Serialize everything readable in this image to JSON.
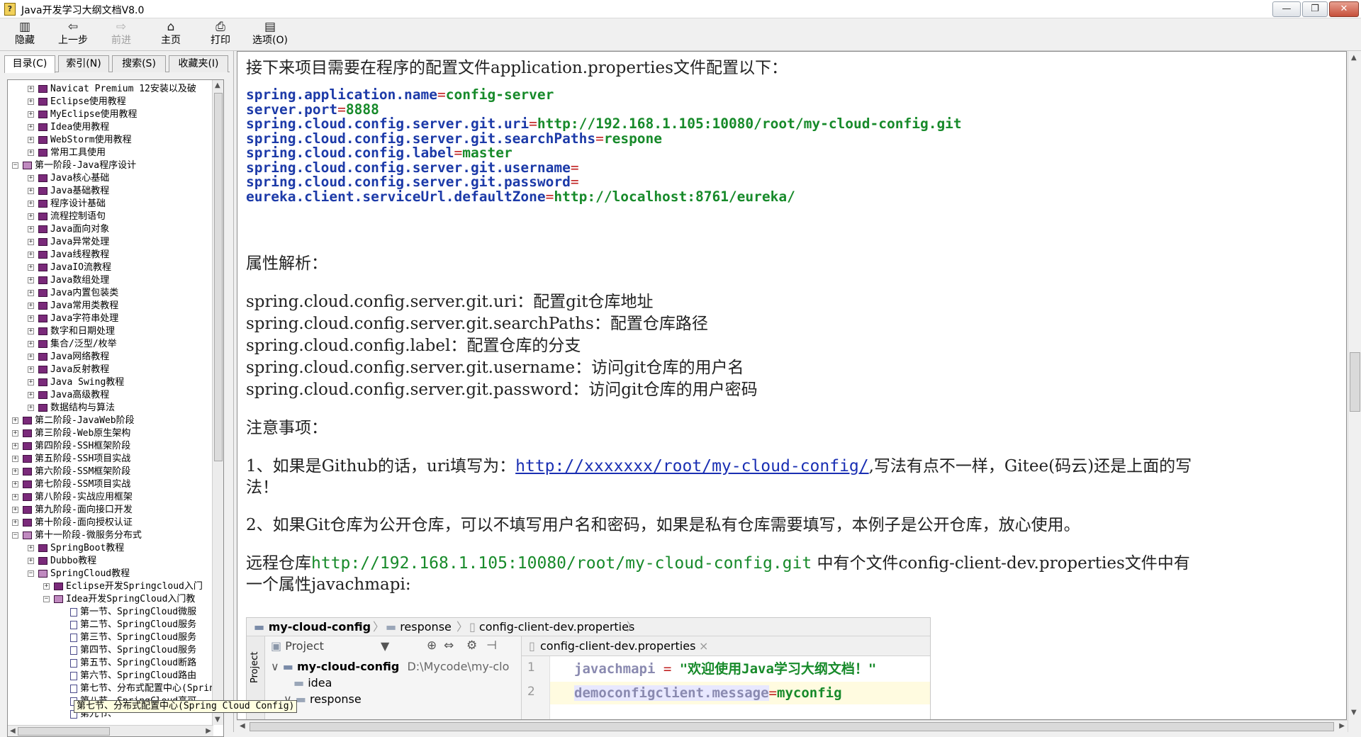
{
  "window": {
    "title": "Java开发学习大纲文档V8.0",
    "app_icon": "?",
    "min_label": "—",
    "max_label": "❐",
    "close_label": "✕"
  },
  "toolbar": {
    "hide": {
      "label": "隐藏",
      "icon": "hide-icon"
    },
    "back": {
      "label": "上一步",
      "icon": "back-arrow-icon"
    },
    "forward": {
      "label": "前进",
      "icon": "forward-arrow-icon"
    },
    "home": {
      "label": "主页",
      "icon": "home-icon"
    },
    "print": {
      "label": "打印",
      "icon": "printer-icon"
    },
    "options": {
      "label": "选项(O)",
      "icon": "options-icon"
    }
  },
  "nav_tabs": [
    "目录(C)",
    "索引(N)",
    "搜索(S)",
    "收藏夹(I)"
  ],
  "tree": [
    {
      "label": "Navicat Premium 12安装以及破",
      "level": 2,
      "type": "book"
    },
    {
      "label": "Eclipse使用教程",
      "level": 2,
      "type": "book"
    },
    {
      "label": "MyEclipse使用教程",
      "level": 2,
      "type": "book"
    },
    {
      "label": "Idea使用教程",
      "level": 2,
      "type": "book"
    },
    {
      "label": "WebStorm使用教程",
      "level": 2,
      "type": "book"
    },
    {
      "label": "常用工具使用",
      "level": 2,
      "type": "book"
    },
    {
      "label": "第一阶段-Java程序设计",
      "level": 1,
      "type": "open"
    },
    {
      "label": "Java核心基础",
      "level": 2,
      "type": "book"
    },
    {
      "label": "Java基础教程",
      "level": 2,
      "type": "book"
    },
    {
      "label": "程序设计基础",
      "level": 2,
      "type": "book"
    },
    {
      "label": "流程控制语句",
      "level": 2,
      "type": "book"
    },
    {
      "label": "Java面向对象",
      "level": 2,
      "type": "book"
    },
    {
      "label": "Java异常处理",
      "level": 2,
      "type": "book"
    },
    {
      "label": "Java线程教程",
      "level": 2,
      "type": "book"
    },
    {
      "label": "JavaIO流教程",
      "level": 2,
      "type": "book"
    },
    {
      "label": "Java数组处理",
      "level": 2,
      "type": "book"
    },
    {
      "label": "Java内置包装类",
      "level": 2,
      "type": "book"
    },
    {
      "label": "Java常用类教程",
      "level": 2,
      "type": "book"
    },
    {
      "label": "Java字符串处理",
      "level": 2,
      "type": "book"
    },
    {
      "label": "数字和日期处理",
      "level": 2,
      "type": "book"
    },
    {
      "label": "集合/泛型/枚举",
      "level": 2,
      "type": "book"
    },
    {
      "label": "Java网络教程",
      "level": 2,
      "type": "book"
    },
    {
      "label": "Java反射教程",
      "level": 2,
      "type": "book"
    },
    {
      "label": "Java Swing教程",
      "level": 2,
      "type": "book"
    },
    {
      "label": "Java高级教程",
      "level": 2,
      "type": "book"
    },
    {
      "label": "数据结构与算法",
      "level": 2,
      "type": "book"
    },
    {
      "label": "第二阶段-JavaWeb阶段",
      "level": 1,
      "type": "book"
    },
    {
      "label": "第三阶段-Web原生架构",
      "level": 1,
      "type": "book"
    },
    {
      "label": "第四阶段-SSH框架阶段",
      "level": 1,
      "type": "book"
    },
    {
      "label": "第五阶段-SSH项目实战",
      "level": 1,
      "type": "book"
    },
    {
      "label": "第六阶段-SSM框架阶段",
      "level": 1,
      "type": "book"
    },
    {
      "label": "第七阶段-SSM项目实战",
      "level": 1,
      "type": "book"
    },
    {
      "label": "第八阶段-实战应用框架",
      "level": 1,
      "type": "book"
    },
    {
      "label": "第九阶段-面向接口开发",
      "level": 1,
      "type": "book"
    },
    {
      "label": "第十阶段-面向授权认证",
      "level": 1,
      "type": "book"
    },
    {
      "label": "第十一阶段-微服务分布式",
      "level": 1,
      "type": "open"
    },
    {
      "label": "SpringBoot教程",
      "level": 2,
      "type": "book"
    },
    {
      "label": "Dubbo教程",
      "level": 2,
      "type": "book"
    },
    {
      "label": "SpringCloud教程",
      "level": 2,
      "type": "open"
    },
    {
      "label": "Eclipse开发Springcloud入门",
      "level": 3,
      "type": "book"
    },
    {
      "label": "Idea开发SpringCloud入门教",
      "level": 3,
      "type": "open"
    },
    {
      "label": "第一节、SpringCloud微服",
      "level": 4,
      "type": "page"
    },
    {
      "label": "第二节、SpringCloud服务",
      "level": 4,
      "type": "page"
    },
    {
      "label": "第三节、SpringCloud服务",
      "level": 4,
      "type": "page"
    },
    {
      "label": "第四节、SpringCloud服务",
      "level": 4,
      "type": "page"
    },
    {
      "label": "第五节、SpringCloud断路",
      "level": 4,
      "type": "page"
    },
    {
      "label": "第六节、SpringCloud路由",
      "level": 4,
      "type": "page"
    },
    {
      "label": "第七节、分布式配置中心(Spring Cloud Config)",
      "level": 4,
      "type": "page"
    },
    {
      "label": "第八节、SpringCloud高可",
      "level": 4,
      "type": "page"
    },
    {
      "label": "第九节、",
      "level": 4,
      "type": "page"
    }
  ],
  "tooltip": "第七节、分布式配置中心(Spring Cloud Config)",
  "content": {
    "intro": "接下来项目需要在程序的配置文件application.properties文件配置以下：",
    "config": [
      {
        "key": "spring.application.name",
        "value": "config-server"
      },
      {
        "key": "server.port",
        "value": "8888"
      },
      {
        "key": "spring.cloud.config.server.git.uri",
        "value": "http://192.168.1.105:10080/root/my-cloud-config.git"
      },
      {
        "key": "spring.cloud.config.server.git.searchPaths",
        "value": "respone"
      },
      {
        "key": "spring.cloud.config.label",
        "value": "master"
      },
      {
        "key": "spring.cloud.config.server.git.username",
        "value": ""
      },
      {
        "key": "spring.cloud.config.server.git.password",
        "value": ""
      },
      {
        "key": "eureka.client.serviceUrl.defaultZone",
        "value": "http://localhost:8761/eureka/"
      }
    ],
    "attr_title": "属性解析：",
    "attrs": [
      "spring.cloud.config.server.git.uri：配置git仓库地址",
      "spring.cloud.config.server.git.searchPaths：配置仓库路径",
      "spring.cloud.config.label：配置仓库的分支",
      "spring.cloud.config.server.git.username：访问git仓库的用户名",
      "spring.cloud.config.server.git.password：访问git仓库的用户密码"
    ],
    "notes_title": "注意事项：",
    "note1_prefix": "1、如果是Github的话，uri填写为：",
    "note1_link": "http://xxxxxxx/root/my-cloud-config/",
    "note1_suffix": ",写法有点不一样，Gitee(码云)还是上面的写",
    "note1_line2": "法！",
    "note2": "2、如果Git仓库为公开仓库，可以不填写用户名和密码，如果是私有仓库需要填写，本例子是公开仓库，放心使用。",
    "remote_prefix": "远程仓库",
    "remote_url": "http://192.168.1.105:10080/root/my-cloud-config.git",
    "remote_suffix": " 中有个文件config-client-dev.properties文件中有",
    "remote_line2": "一个属性javachmapi:"
  },
  "ide": {
    "breadcrumb": [
      "my-cloud-config",
      "response",
      "config-client-dev.properties"
    ],
    "side_label": "Project",
    "project_dropdown": "Project",
    "root_name": "my-cloud-config",
    "root_path": "D:\\Mycode\\my-clo",
    "idea_item": "idea",
    "response_item": "response",
    "editor_tab": "config-client-dev.properties",
    "lines": [
      {
        "num": "1",
        "key": "javachmapi",
        "eq": " = ",
        "value": "\"欢迎使用Java学习大纲文档！\""
      },
      {
        "num": "2",
        "key": "democonfigclient.message",
        "eq": "=",
        "value": "myconfig"
      }
    ]
  },
  "colors": {
    "key": "#1c3aa8",
    "value": "#178a2a",
    "link": "#1a2fb3",
    "book": "#7a2a7a"
  }
}
